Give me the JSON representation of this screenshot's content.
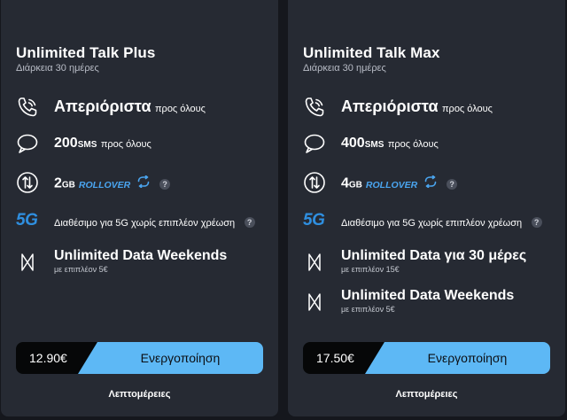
{
  "plans": [
    {
      "name": "Unlimited Talk Plus",
      "duration": "Διάρκεια 30 ημέρες",
      "calls": {
        "main": "Απεριόριστα",
        "suffix": "προς όλους"
      },
      "sms": {
        "count": "200",
        "unit": "SMS",
        "suffix": "προς όλους"
      },
      "data": {
        "amount": "2",
        "unit": "GB",
        "rollover": "ROLLOVER",
        "help": "?"
      },
      "fiveg": {
        "label": "5G",
        "text": "Διαθέσιμο για 5G χωρίς επιπλέον χρέωση",
        "help": "?"
      },
      "extras": [
        {
          "title": "Unlimited Data Weekends",
          "note": "με επιπλέον 5€"
        }
      ],
      "price": "12.90€",
      "activate_label": "Ενεργοποίηση",
      "details_label": "Λεπτομέρειες"
    },
    {
      "name": "Unlimited Talk Max",
      "duration": "Διάρκεια 30 ημέρες",
      "calls": {
        "main": "Απεριόριστα",
        "suffix": "προς όλους"
      },
      "sms": {
        "count": "400",
        "unit": "SMS",
        "suffix": "προς όλους"
      },
      "data": {
        "amount": "4",
        "unit": "GB",
        "rollover": "ROLLOVER",
        "help": "?"
      },
      "fiveg": {
        "label": "5G",
        "text": "Διαθέσιμο για 5G χωρίς επιπλέον χρέωση",
        "help": "?"
      },
      "extras": [
        {
          "title": "Unlimited Data για 30 μέρες",
          "note": "με επιπλέον 15€"
        },
        {
          "title": "Unlimited Data Weekends",
          "note": "με επιπλέον 5€"
        }
      ],
      "price": "17.50€",
      "activate_label": "Ενεργοποίηση",
      "details_label": "Λεπτομέρειες"
    }
  ],
  "colors": {
    "background": "#15171d",
    "card": "#262a33",
    "accent": "#5db8f5",
    "rollover": "#4aa5f0",
    "price_box": "#060708"
  },
  "icons": [
    "phone-icon",
    "chat-bubble-icon",
    "data-transfer-icon",
    "5g-icon",
    "bowtie-icon",
    "rollover-refresh-icon",
    "help-icon"
  ]
}
